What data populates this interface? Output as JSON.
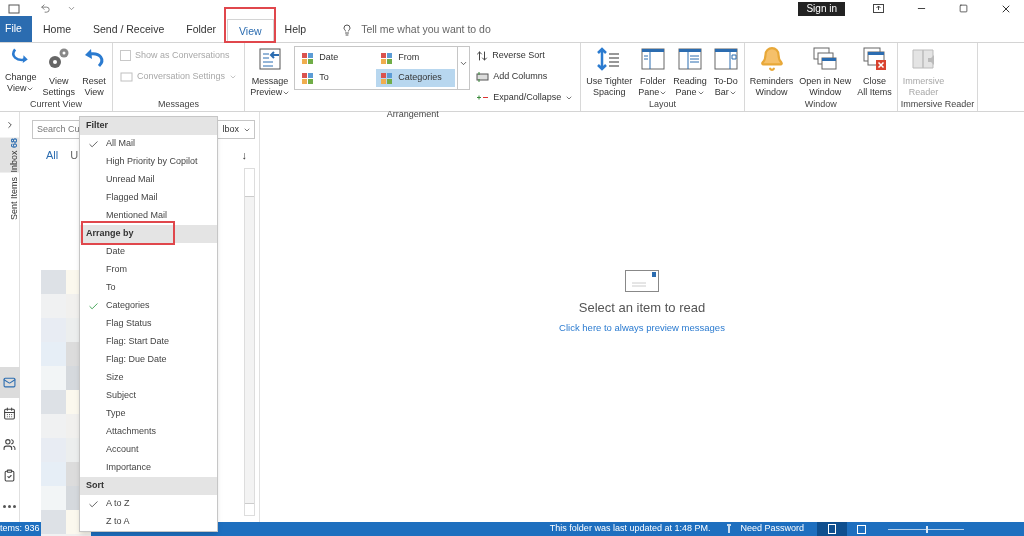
{
  "title_bar": {
    "sign_in": "Sign in"
  },
  "tabs": [
    {
      "label": "File",
      "kind": "file",
      "selected": false,
      "highlighted": false
    },
    {
      "label": "Home",
      "kind": "tab",
      "selected": false,
      "highlighted": false
    },
    {
      "label": "Send / Receive",
      "kind": "tab",
      "selected": false,
      "highlighted": false
    },
    {
      "label": "Folder",
      "kind": "tab",
      "selected": false,
      "highlighted": false
    },
    {
      "label": "View",
      "kind": "tab",
      "selected": true,
      "highlighted": true
    },
    {
      "label": "Help",
      "kind": "tab",
      "selected": false,
      "highlighted": false
    }
  ],
  "tell_me": {
    "placeholder": "Tell me what you want to do"
  },
  "ribbon": {
    "groups": [
      {
        "label": "Current View",
        "items": [
          {
            "kind": "large",
            "label": "Change",
            "label2": "View",
            "dropdown": true,
            "disabled": false
          },
          {
            "kind": "large",
            "label": "View",
            "label2": "Settings",
            "dropdown": false,
            "disabled": false
          },
          {
            "kind": "large",
            "label": "Reset",
            "label2": "View",
            "dropdown": false,
            "disabled": false
          }
        ]
      },
      {
        "label": "Messages",
        "items": [
          {
            "kind": "stack",
            "rows": [
              {
                "kind": "checkbox",
                "label": "Show as Conversations",
                "checked": false,
                "disabled": true
              },
              {
                "kind": "menu",
                "label": "Conversation Settings",
                "disabled": true
              }
            ]
          }
        ]
      },
      {
        "label": "Arrangement",
        "items": [
          {
            "kind": "large",
            "label": "Message",
            "label2": "Preview",
            "dropdown": true,
            "disabled": false
          },
          {
            "kind": "gallery",
            "options": [
              {
                "label": "Date",
                "selected": false
              },
              {
                "label": "From",
                "selected": false
              },
              {
                "label": "To",
                "selected": false
              },
              {
                "label": "Categories",
                "selected": true
              }
            ]
          },
          {
            "kind": "stack",
            "rows": [
              {
                "kind": "sort",
                "label": "Reverse Sort",
                "disabled": false
              },
              {
                "kind": "columns",
                "label": "Add Columns",
                "disabled": false
              },
              {
                "kind": "expand",
                "label": "Expand/Collapse",
                "disabled": false
              }
            ]
          }
        ]
      },
      {
        "label": "Layout",
        "items": [
          {
            "kind": "large",
            "label": "Use Tighter",
            "label2": "Spacing",
            "dropdown": false,
            "disabled": false
          },
          {
            "kind": "large",
            "label": "Folder",
            "label2": "Pane",
            "dropdown": true,
            "disabled": false
          },
          {
            "kind": "large",
            "label": "Reading",
            "label2": "Pane",
            "dropdown": true,
            "disabled": false
          },
          {
            "kind": "large",
            "label": "To-Do",
            "label2": "Bar",
            "dropdown": true,
            "disabled": false
          }
        ]
      },
      {
        "label": "Window",
        "items": [
          {
            "kind": "large",
            "label": "Reminders",
            "label2": "Window",
            "dropdown": false,
            "disabled": false
          },
          {
            "kind": "large",
            "label": "Open in New",
            "label2": "Window",
            "dropdown": false,
            "disabled": false
          },
          {
            "kind": "large",
            "label": "Close",
            "label2": "All Items",
            "dropdown": false,
            "disabled": false
          }
        ]
      },
      {
        "label": "Immersive Reader",
        "items": [
          {
            "kind": "large",
            "label": "Immersive",
            "label2": "Reader",
            "dropdown": false,
            "disabled": true
          }
        ]
      }
    ]
  },
  "nav": {
    "folders": [
      {
        "label": "Inbox",
        "count": "68",
        "selected": true
      },
      {
        "label": "Sent Items",
        "selected": false
      }
    ],
    "modules": [
      {
        "kind": "mail",
        "selected": true
      },
      {
        "kind": "calendar",
        "selected": false
      },
      {
        "kind": "people",
        "selected": false
      },
      {
        "kind": "tasks",
        "selected": false
      },
      {
        "kind": "more",
        "selected": false
      }
    ]
  },
  "list": {
    "search": {
      "placeholder": "Search Cu",
      "scope": "lbox"
    },
    "filters": [
      {
        "label": "All",
        "selected": true
      },
      {
        "label": "U",
        "selected": false
      }
    ],
    "sort_arrow": "↓"
  },
  "menu": {
    "sections": [
      {
        "header": "Filter",
        "highlighted": false,
        "items": [
          {
            "label": "All Mail",
            "checked": true
          },
          {
            "label": "High Priority by Copilot",
            "checked": false
          },
          {
            "label": "Unread Mail",
            "checked": false
          },
          {
            "label": "Flagged Mail",
            "checked": false
          },
          {
            "label": "Mentioned Mail",
            "checked": false
          }
        ]
      },
      {
        "header": "Arrange by",
        "highlighted": true,
        "items": [
          {
            "label": "Date",
            "checked": false
          },
          {
            "label": "From",
            "checked": false
          },
          {
            "label": "To",
            "checked": false
          },
          {
            "label": "Categories",
            "checked": true
          },
          {
            "label": "Flag Status",
            "checked": false
          },
          {
            "label": "Flag: Start Date",
            "checked": false
          },
          {
            "label": "Flag: Due Date",
            "checked": false
          },
          {
            "label": "Size",
            "checked": false
          },
          {
            "label": "Subject",
            "checked": false
          },
          {
            "label": "Type",
            "checked": false
          },
          {
            "label": "Attachments",
            "checked": false
          },
          {
            "label": "Account",
            "checked": false
          },
          {
            "label": "Importance",
            "checked": false
          }
        ]
      },
      {
        "header": "Sort",
        "highlighted": false,
        "items": [
          {
            "label": "A to Z",
            "checked": true
          },
          {
            "label": "Z to A",
            "checked": false
          }
        ]
      }
    ]
  },
  "reading_pane": {
    "title": "Select an item to read",
    "link": "Click here to always preview messages"
  },
  "status_bar": {
    "items": "tems: 936",
    "updated": "This folder was last updated at 1:48 PM.",
    "password": "Need Password",
    "zoom": {
      "level": 0.5
    }
  }
}
